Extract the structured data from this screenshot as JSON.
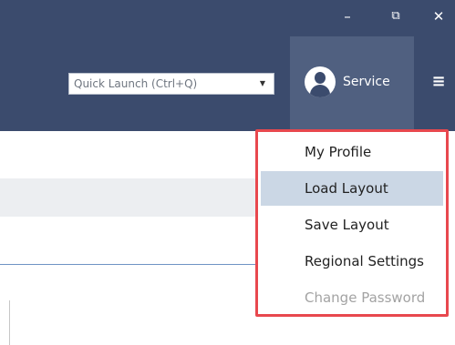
{
  "titlebar": {
    "minimize_glyph": "–",
    "restore_glyph": "⧉",
    "close_glyph": "✕"
  },
  "quick_launch": {
    "placeholder": "Quick Launch (Ctrl+Q)",
    "dropdown_glyph": "▼"
  },
  "user": {
    "name": "Service",
    "avatar_icon": "user-avatar-icon"
  },
  "hamburger_glyph": "≡",
  "menu": {
    "items": [
      {
        "label": "My Profile",
        "state": "normal"
      },
      {
        "label": "Load Layout",
        "state": "hover"
      },
      {
        "label": "Save Layout",
        "state": "normal"
      },
      {
        "label": "Regional Settings",
        "state": "normal"
      },
      {
        "label": "Change Password",
        "state": "disabled"
      }
    ]
  },
  "colors": {
    "header": "#3b4b6d",
    "service_active": "#506080",
    "menu_highlight": "#cbd7e5",
    "menu_border": "#e8484e"
  }
}
